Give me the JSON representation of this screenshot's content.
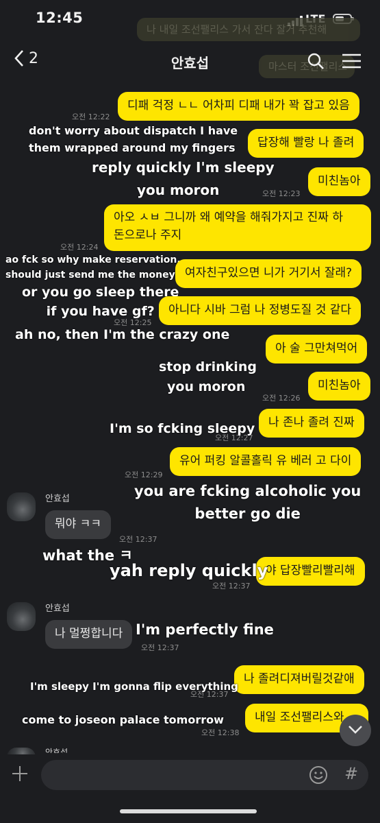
{
  "status": {
    "time": "12:45",
    "network": "LTE"
  },
  "ghost_notifications": [
    "나 내일 조선팰리스 가서 잔다 잘거 추천해",
    "마스터 조선팰리스"
  ],
  "header": {
    "back_count": "2",
    "chat_title": "안효섭",
    "search_icon": "search-icon",
    "menu_icon": "menu-icon"
  },
  "messages": [
    {
      "text": "디패 걱정 ㄴㄴ 어차피 디패 내가 꽉 잡고 있음",
      "time": "오전 12:22",
      "translation": "don't worry about dispatch I have\nthem wrapped around my fingers"
    },
    {
      "text": "답장해 빨랑 나 졸려",
      "translation": "reply quickly I'm sleepy"
    },
    {
      "text": "미친놈아",
      "time": "오전 12:23",
      "translation": "you moron"
    },
    {
      "text": "아오 ㅅㅂ 그니까 왜 예약을 해줘가지고 진짜 하\n돈으로나 주지",
      "time": "오전 12:24",
      "translation": "ao fck so why make reservation,\nshould just send me the money"
    },
    {
      "text": "여자친구있으면 니가 거기서 잘래?",
      "translation": "or you go sleep there\nif you have gf?"
    },
    {
      "text": "아니다 시바 그럼 나 정병도질 것 같다",
      "time": "오전 12:25",
      "translation": "ah no, then I'm the crazy one"
    },
    {
      "text": "아 술 그만쳐먹어",
      "translation": "stop drinking"
    },
    {
      "text": "미친놈아",
      "time": "오전 12:26",
      "translation": "you moron"
    },
    {
      "text": "나 존나 졸려 진짜",
      "time": "오전 12:27",
      "translation": "I'm so fcking sleepy"
    },
    {
      "text": "유어 퍼킹 알콜홀릭 유 베러 고 다이",
      "time": "오전 12:29",
      "translation": "you are fcking alcoholic you\nbetter go die"
    },
    {
      "sender": "안효섭",
      "text": "뭐야 ㅋㅋ",
      "time": "오전 12:37",
      "translation": "what the ㅋ"
    },
    {
      "text": "야 답장빨리빨리해",
      "time": "오전 12:37",
      "translation": "yah reply quickly"
    },
    {
      "sender": "안효섭",
      "text": "나 멀쩡합니다",
      "time": "오전 12:37",
      "translation": "I'm perfectly fine"
    },
    {
      "text": "나 졸려디져버릴것같애",
      "time": "오전 12:37",
      "translation": "I'm sleepy I'm gonna flip everything"
    },
    {
      "text": "내일 조선팰리스와",
      "time": "오전 12:38",
      "translation": "come to joseon palace tomorrow"
    }
  ],
  "partial_sender": "안효섭",
  "input": {
    "plus_icon": "plus-icon",
    "emoji_icon": "emoji-icon",
    "hash_icon": "#"
  },
  "colors": {
    "background": "#1c1d20",
    "my_bubble": "#fee500",
    "their_bubble": "#3a3b3e"
  }
}
